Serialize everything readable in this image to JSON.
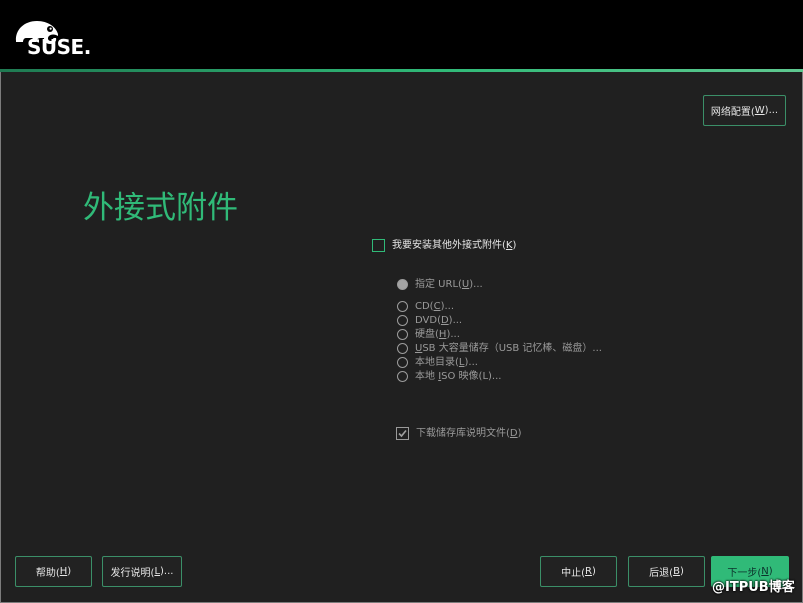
{
  "app": {
    "logo_text": "SUSE.",
    "logo_icon": "suse-chameleon-icon"
  },
  "theme": {
    "accent": "#30ba78",
    "header_bg": "#000000",
    "panel_bg": "#202020",
    "text": "#e6e6e6",
    "disabled_text": "#9a9a9a",
    "button_border": "#3b8f68",
    "primary_text": "#0c322c"
  },
  "header": {
    "network_config": {
      "pre": "网络配置(",
      "key": "W",
      "post": ")..."
    }
  },
  "page": {
    "title": "外接式附件"
  },
  "addons": {
    "install_other": {
      "checked": false,
      "pre": "我要安装其他外接式附件(",
      "key": "K",
      "post": ")"
    },
    "sources": [
      {
        "selected": true,
        "pre": "指定 URL(",
        "key": "U",
        "post": ")..."
      },
      {
        "selected": false,
        "pre": "CD(",
        "key": "C",
        "post": ")..."
      },
      {
        "selected": false,
        "pre": "DVD(",
        "key": "D",
        "post": ")..."
      },
      {
        "selected": false,
        "pre": "硬盘(",
        "key": "H",
        "post": ")..."
      },
      {
        "selected": false,
        "key": "U",
        "post": "SB 大容量储存（USB 记忆棒、磁盘）..."
      },
      {
        "selected": false,
        "pre": "本地目录(",
        "key": "L",
        "post": ")..."
      },
      {
        "selected": false,
        "pre": "本地 ",
        "key": "I",
        "post": "SO 映像(L)..."
      }
    ],
    "download_descriptions": {
      "checked": true,
      "pre": "下载储存库说明文件(",
      "key": "D",
      "post": ")"
    }
  },
  "footer": {
    "help": {
      "pre": "帮助(",
      "key": "H",
      "post": ")"
    },
    "release_notes": {
      "pre": "发行说明(",
      "key": "L",
      "post": ")..."
    },
    "abort": {
      "pre": "中止(",
      "key": "R",
      "post": ")"
    },
    "back": {
      "pre": "后退(",
      "key": "B",
      "post": ")"
    },
    "next": {
      "pre": "下一步(",
      "key": "N",
      "post": ")"
    }
  },
  "watermark": "@ITPUB博客"
}
